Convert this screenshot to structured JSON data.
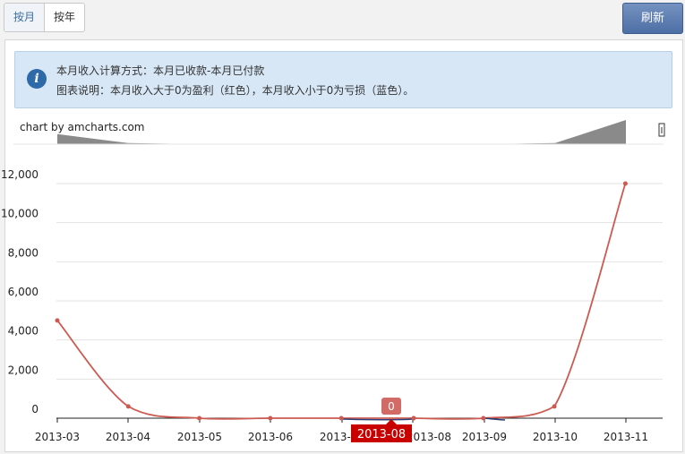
{
  "toolbar": {
    "tab_month": "按月",
    "tab_year": "按年",
    "refresh_label": "刷新"
  },
  "info": {
    "line1": "本月收入计算方式：本月已收款-本月已付款",
    "line2": "图表说明：本月收入大于0为盈利（红色），本月收入小于0为亏损（蓝色）。"
  },
  "chart_credit": "chart by amcharts.com",
  "colors": {
    "profit": "#cc5a50",
    "loss": "#2a3f7a",
    "cursor_label_bg": "#c80000",
    "balloon_bg": "#d26a66",
    "grid": "#e2e2e2",
    "scrollbar_fill": "#8a8a8a"
  },
  "chart_data": {
    "type": "line",
    "categories": [
      "2013-03",
      "2013-04",
      "2013-05",
      "2013-06",
      "2013-07",
      "2013-08",
      "2013-08",
      "2013-09",
      "2013-10",
      "2013-11"
    ],
    "values": [
      5000,
      600,
      0,
      0,
      0,
      0,
      0,
      0,
      600,
      12000
    ],
    "ylim": [
      0,
      12000
    ],
    "yticks": [
      0,
      2000,
      4000,
      6000,
      8000,
      10000,
      12000
    ],
    "ytick_labels": [
      "0",
      "2,000",
      "4,000",
      "6,000",
      "8,000",
      "10,000",
      "12,000"
    ],
    "xtick_labels": [
      "2013-03",
      "2013-04",
      "2013-05",
      "2013-06",
      "2013-07",
      "2013-08",
      "2013-09",
      "2013-10",
      "2013-11"
    ],
    "cursor": {
      "category": "2013-08",
      "value_label": "0"
    },
    "grid": true
  }
}
